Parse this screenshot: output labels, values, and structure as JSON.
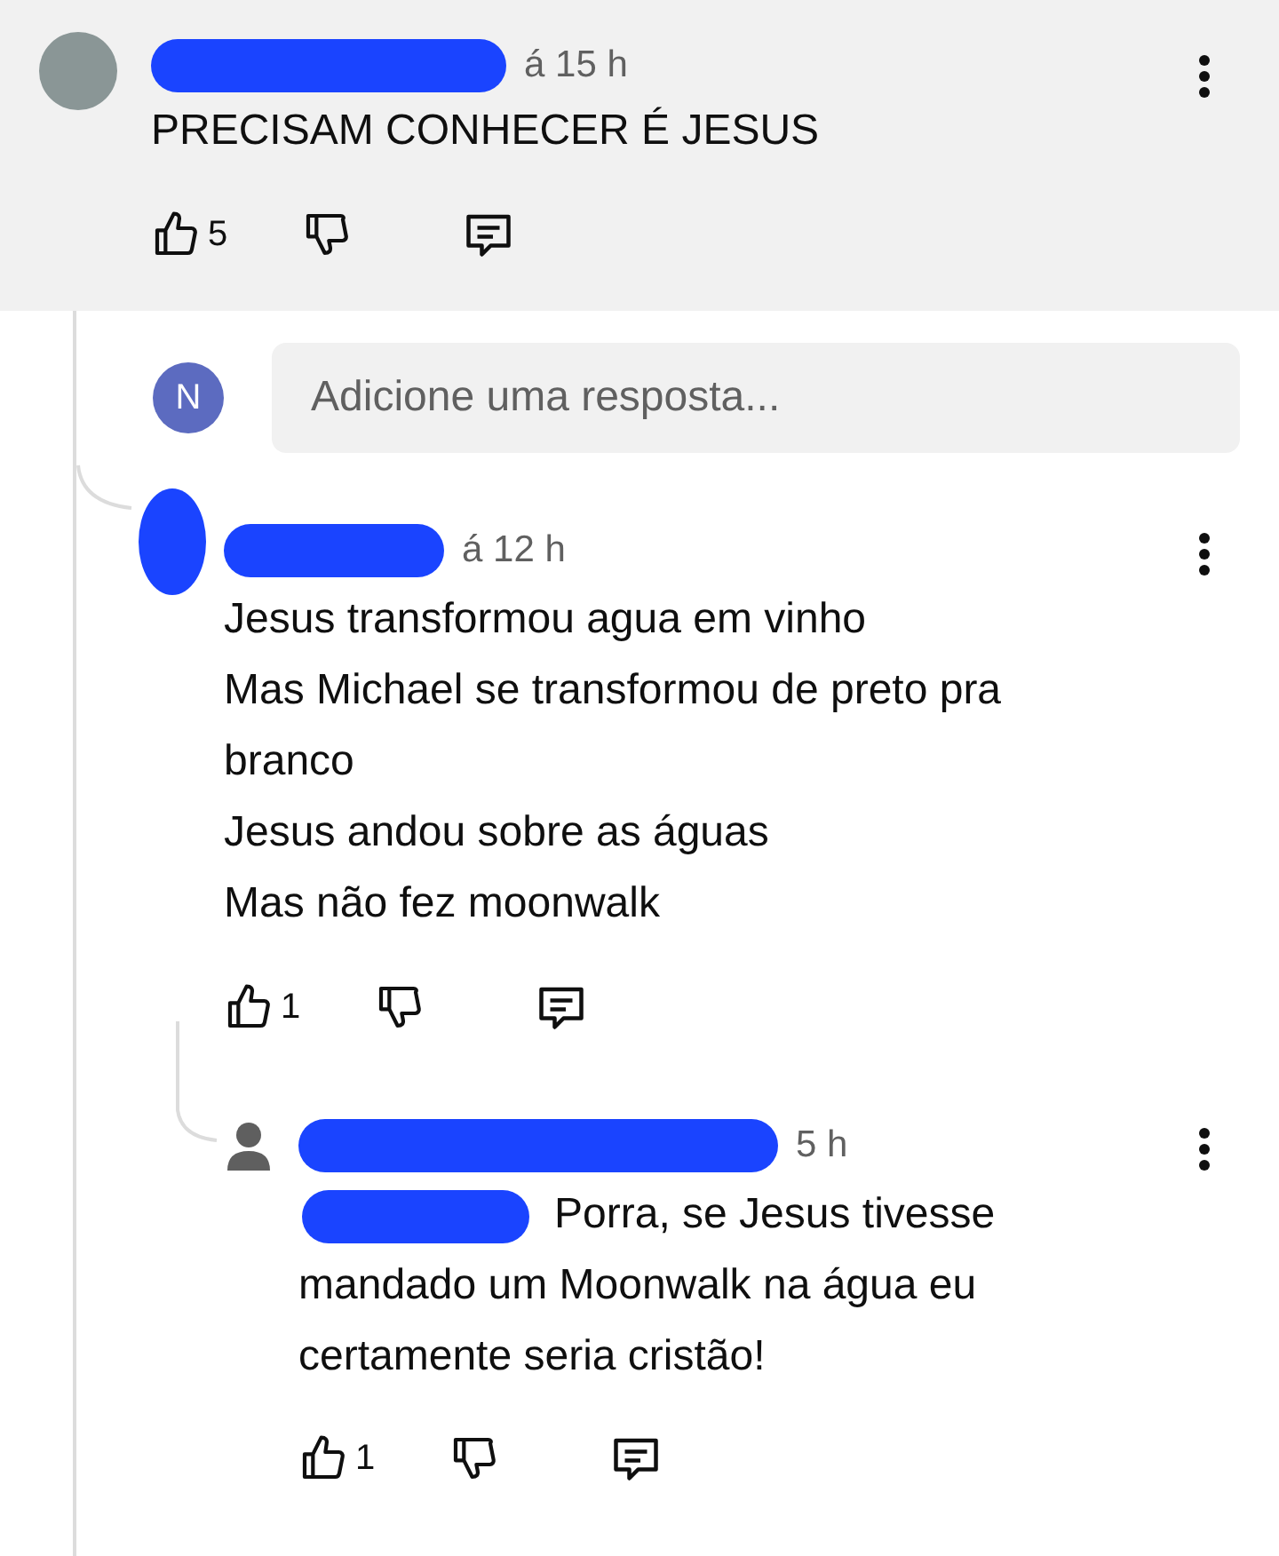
{
  "comments": [
    {
      "kind": "photo",
      "time": "á 15 h",
      "lines": [
        "PRECISAM CONHECER É JESUS"
      ],
      "likes": "5",
      "highlighted": true
    },
    {
      "kind": "hidden",
      "time": "á 12 h",
      "lines": [
        "Jesus transformou agua em vinho",
        "Mas Michael se transformou de preto pra",
        "branco",
        "Jesus andou sobre as águas",
        "Mas não fez moonwalk"
      ],
      "likes": "1",
      "highlighted": false
    },
    {
      "kind": "person",
      "time": "5 h",
      "lines": [
        "Porra, se Jesus tivesse",
        "mandado um Moonwalk na água eu",
        "certamente seria cristão!"
      ],
      "likes": "1",
      "highlighted": false
    }
  ],
  "reply_box": {
    "avatar_letter": "N",
    "placeholder": "Adicione uma resposta..."
  }
}
